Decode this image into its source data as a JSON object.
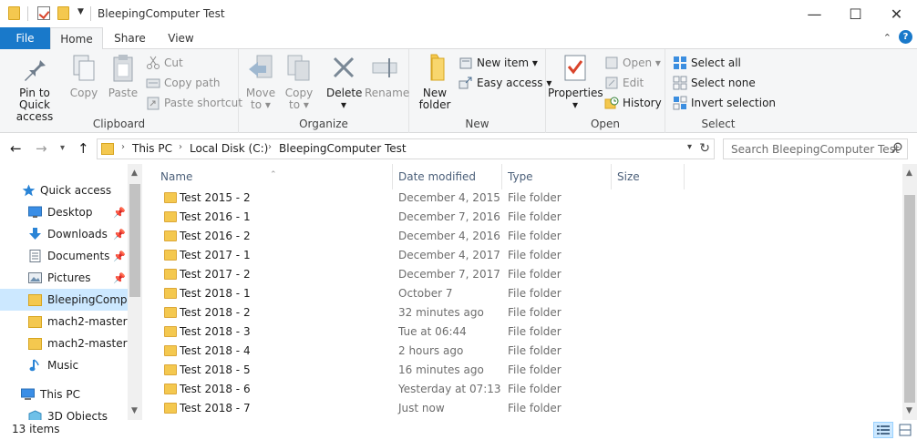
{
  "window": {
    "title": "BleepingComputer Test",
    "controls": {
      "minimize": "—",
      "maximize": "☐",
      "close": "✕"
    }
  },
  "ribbon_tabs": [
    "File",
    "Home",
    "Share",
    "View"
  ],
  "ribbon": {
    "clipboard": {
      "label": "Clipboard",
      "pin": "Pin to Quick access",
      "pin_l1": "Pin to Quick",
      "pin_l2": "access",
      "copy": "Copy",
      "paste": "Paste",
      "cut": "Cut",
      "copy_path": "Copy path",
      "paste_shortcut": "Paste shortcut"
    },
    "organize": {
      "label": "Organize",
      "move_to": "Move",
      "move_to_l2": "to",
      "copy_to": "Copy",
      "copy_to_l2": "to",
      "delete": "Delete",
      "rename": "Rename"
    },
    "new": {
      "label": "New",
      "new_folder_l1": "New",
      "new_folder_l2": "folder",
      "new_item": "New item",
      "easy_access": "Easy access"
    },
    "open": {
      "label": "Open",
      "properties": "Properties",
      "open": "Open",
      "edit": "Edit",
      "history": "History"
    },
    "select": {
      "label": "Select",
      "select_all": "Select all",
      "select_none": "Select none",
      "invert_selection": "Invert selection"
    }
  },
  "address": {
    "breadcrumbs": [
      "This PC",
      "Local Disk (C:)",
      "BleepingComputer Test"
    ],
    "search_placeholder": "Search BleepingComputer Test"
  },
  "nav": {
    "items": [
      {
        "label": "Quick access",
        "icon": "star-icon",
        "pinned": false
      },
      {
        "label": "Desktop",
        "icon": "desktop-icon",
        "pinned": true
      },
      {
        "label": "Downloads",
        "icon": "download-icon",
        "pinned": true
      },
      {
        "label": "Documents",
        "icon": "documents-icon",
        "pinned": true
      },
      {
        "label": "Pictures",
        "icon": "pictures-icon",
        "pinned": true
      },
      {
        "label": "BleepingCompu",
        "icon": "folder-icon",
        "pinned": false,
        "selected": true
      },
      {
        "label": "mach2-master",
        "icon": "folder-icon",
        "pinned": false
      },
      {
        "label": "mach2-master",
        "icon": "folder-icon",
        "pinned": false
      },
      {
        "label": "Music",
        "icon": "music-icon",
        "pinned": false
      },
      {
        "label": "This PC",
        "icon": "computer-icon",
        "pinned": false
      },
      {
        "label": "3D Objects",
        "icon": "cube-icon",
        "pinned": false
      }
    ],
    "pin_glyph": "📌"
  },
  "columns": [
    "Name",
    "Date modified",
    "Type",
    "Size"
  ],
  "files": [
    {
      "name": "Test 2015 - 2",
      "date": "December 4, 2015",
      "type": "File folder"
    },
    {
      "name": "Test 2016 - 1",
      "date": "December 7, 2016",
      "type": "File folder"
    },
    {
      "name": "Test 2016 - 2",
      "date": "December 4, 2016",
      "type": "File folder"
    },
    {
      "name": "Test 2017 - 1",
      "date": "December 4, 2017",
      "type": "File folder"
    },
    {
      "name": "Test 2017 - 2",
      "date": "December 7, 2017",
      "type": "File folder"
    },
    {
      "name": "Test 2018 - 1",
      "date": "October 7",
      "type": "File folder"
    },
    {
      "name": "Test 2018 - 2",
      "date": "32 minutes ago",
      "type": "File folder"
    },
    {
      "name": "Test 2018 - 3",
      "date": "Tue at 06:44",
      "type": "File folder"
    },
    {
      "name": "Test 2018 - 4",
      "date": "2 hours ago",
      "type": "File folder"
    },
    {
      "name": "Test 2018 - 5",
      "date": "16 minutes ago",
      "type": "File folder"
    },
    {
      "name": "Test 2018 - 6",
      "date": "Yesterday at 07:13",
      "type": "File folder"
    },
    {
      "name": "Test 2018 - 7",
      "date": "Just now",
      "type": "File folder"
    }
  ],
  "status": {
    "item_count": "13 items"
  },
  "colors": {
    "accent": "#1979ca",
    "folder": "#f4c84f",
    "selection": "#cce8ff"
  }
}
